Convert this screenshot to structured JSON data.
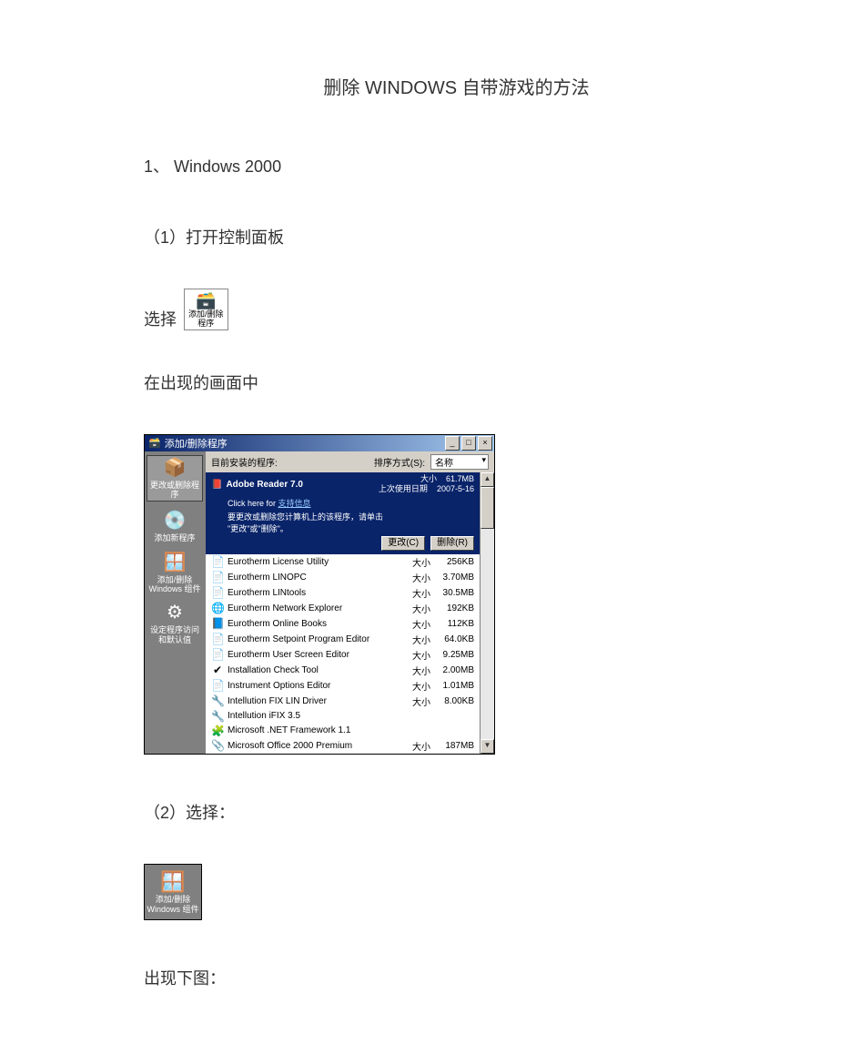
{
  "doc": {
    "title": "删除 WINDOWS 自带游戏的方法",
    "section1_heading": "1、  Windows  2000",
    "step1_label": "（1）打开控制面板",
    "choose_word": "选择",
    "cp_icon_label": "添加/删除\n程序",
    "after_label": "在出现的画面中",
    "step2_label": "（2）选择：",
    "side_thumb_label": "添加/删除\nWindows 组件",
    "next_label": "出现下图："
  },
  "arp": {
    "window_title": "添加/删除程序",
    "sidebar": [
      {
        "label": "更改或删除程\n序",
        "icon": "📦"
      },
      {
        "label": "添加新程序",
        "icon": "💿"
      },
      {
        "label": "添加/删除\nWindows 组件",
        "icon": "🪟"
      },
      {
        "label": "设定程序访问\n和默认值",
        "icon": "⚙"
      }
    ],
    "current_label": "目前安装的程序:",
    "sort_label": "排序方式(S):",
    "sort_value": "名称",
    "selected": {
      "name": "Adobe Reader 7.0",
      "size_label": "大小",
      "size_value": "61.7MB",
      "used_label": "上次使用日期",
      "used_value": "2007-5-16",
      "click_here": "Click here for",
      "support": "支持信息",
      "hint": "要更改或删除您计算机上的该程序，请单击\n\"更改\"或\"删除\"。",
      "change_btn": "更改(C)",
      "remove_btn": "删除(R)"
    },
    "size_col": "大小",
    "programs": [
      {
        "icon": "📄",
        "name": "Eurotherm License Utility",
        "size": "256KB"
      },
      {
        "icon": "📄",
        "name": "Eurotherm LINOPC",
        "size": "3.70MB"
      },
      {
        "icon": "📄",
        "name": "Eurotherm LINtools",
        "size": "30.5MB"
      },
      {
        "icon": "🌐",
        "name": "Eurotherm Network Explorer",
        "size": "192KB"
      },
      {
        "icon": "📘",
        "name": "Eurotherm Online Books",
        "size": "112KB"
      },
      {
        "icon": "📄",
        "name": "Eurotherm Setpoint Program Editor",
        "size": "64.0KB"
      },
      {
        "icon": "📄",
        "name": "Eurotherm User Screen Editor",
        "size": "9.25MB"
      },
      {
        "icon": "✔",
        "name": "Installation Check Tool",
        "size": "2.00MB"
      },
      {
        "icon": "📄",
        "name": "Instrument Options Editor",
        "size": "1.01MB"
      },
      {
        "icon": "🔧",
        "name": "Intellution FIX LIN Driver",
        "size": "8.00KB"
      },
      {
        "icon": "🔧",
        "name": "Intellution iFIX 3.5",
        "size": ""
      },
      {
        "icon": "🧩",
        "name": "Microsoft .NET Framework 1.1",
        "size": ""
      },
      {
        "icon": "📎",
        "name": "Microsoft Office 2000 Premium",
        "size": "187MB"
      }
    ]
  }
}
